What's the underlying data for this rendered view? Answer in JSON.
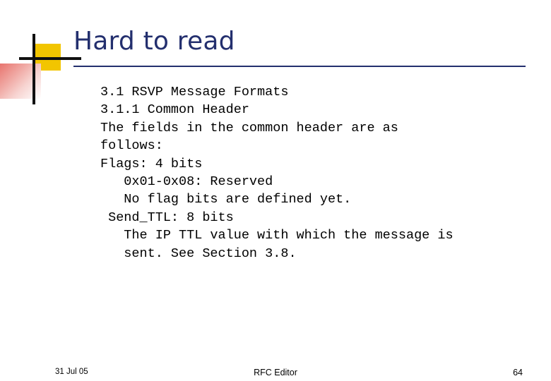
{
  "slide": {
    "title": "Hard to read",
    "body_lines": [
      "3.1 RSVP Message Formats",
      "3.1.1 Common Header",
      "The fields in the common header are as",
      "follows:",
      "Flags: 4 bits",
      "   0x01-0x08: Reserved",
      "   No flag bits are defined yet.",
      " Send_TTL: 8 bits",
      "   The IP TTL value with which the message is",
      "   sent. See Section 3.8."
    ],
    "body_text": "3.1 RSVP Message Formats\n3.1.1 Common Header\nThe fields in the common header are as\nfollows:\nFlags: 4 bits\n   0x01-0x08: Reserved\n   No flag bits are defined yet.\n Send_TTL: 8 bits\n   The IP TTL value with which the message is\n   sent. See Section 3.8.",
    "footer": {
      "date": "31 Jul 05",
      "center": "RFC Editor",
      "page_number": "64"
    },
    "colors": {
      "title": "#232f6e",
      "rule": "#232f6e",
      "accent_yellow": "#f2c500",
      "accent_red": "#e8746e",
      "bars": "#101010",
      "body_text": "#000000",
      "background": "#ffffff"
    }
  }
}
